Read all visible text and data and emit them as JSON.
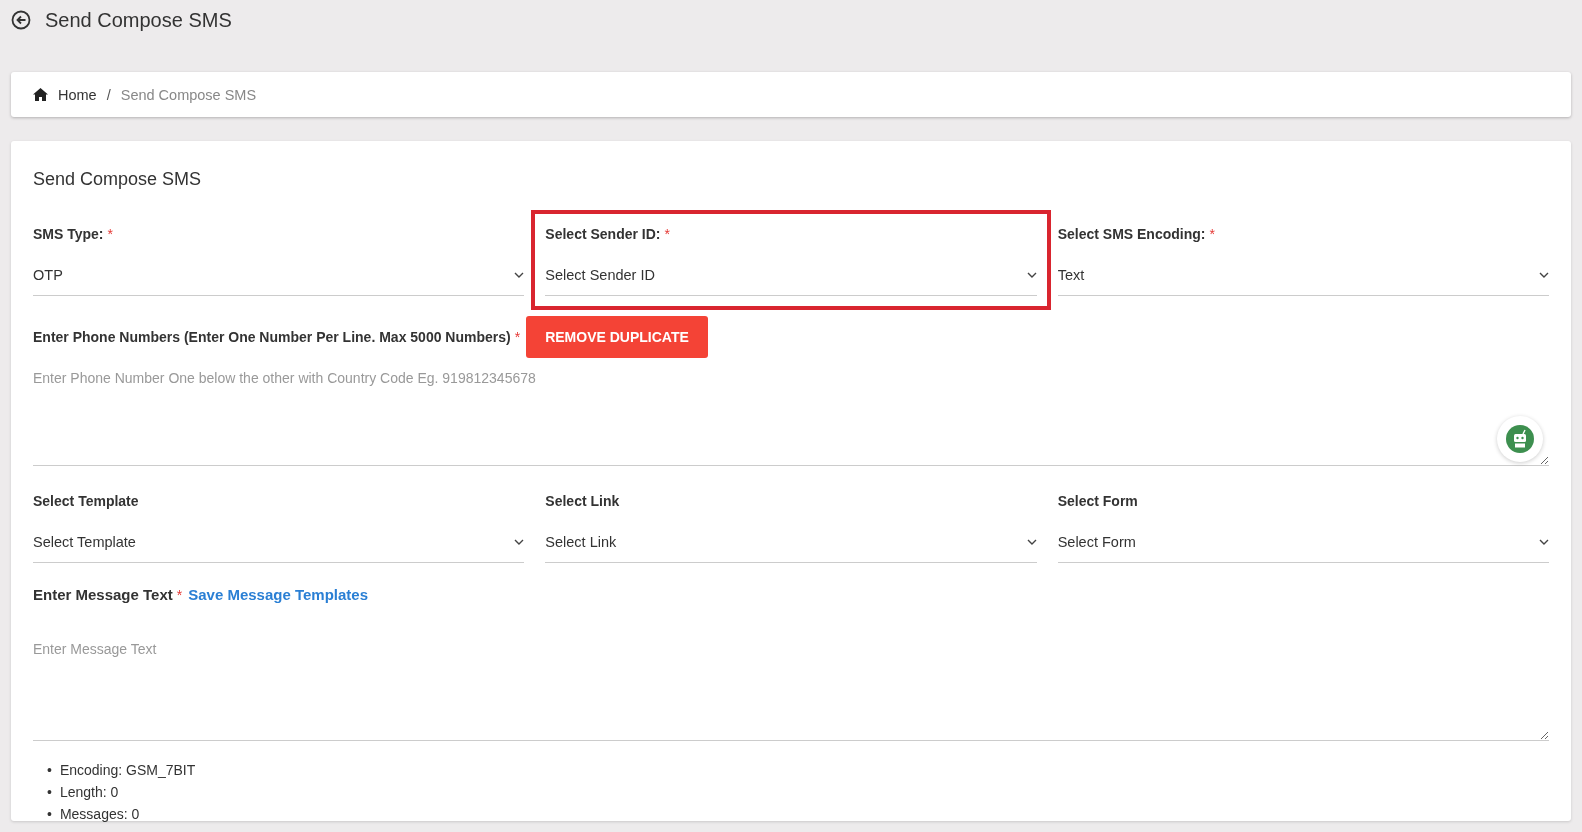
{
  "header": {
    "title": "Send Compose SMS"
  },
  "breadcrumb": [
    {
      "label": "Home",
      "current": false
    },
    {
      "label": "Send Compose SMS",
      "current": true,
      "separator": "/"
    }
  ],
  "form": {
    "title": "Send Compose SMS",
    "row_1": [
      {
        "label": "SMS Type:",
        "required_mark": "*",
        "value": "OTP",
        "highlighted": false
      },
      {
        "label": "Select Sender ID:",
        "required_mark": "*",
        "value": "Select Sender ID",
        "highlighted": true
      },
      {
        "label": "Select SMS Encoding:",
        "required_mark": "*",
        "value": "Text",
        "highlighted": false
      }
    ],
    "phone": {
      "label": "Enter Phone Numbers (Enter One Number Per Line. Max 5000 Numbers)",
      "required_mark": "*",
      "button": "REMOVE DUPLICATE",
      "placeholder": "Enter Phone Number One below the other with Country Code Eg. 919812345678"
    },
    "row_2": [
      {
        "label": "Select Template",
        "value": "Select Template",
        "highlighted": false
      },
      {
        "label": "Select Link",
        "value": "Select Link",
        "highlighted": false
      },
      {
        "label": "Select Form",
        "value": "Select Form",
        "highlighted": false
      }
    ],
    "message": {
      "label": "Enter Message Text",
      "required_mark": "*",
      "link": "Save Message Templates",
      "placeholder": "Enter Message Text"
    },
    "stats": [
      {
        "bullet": "•",
        "text": "Encoding: GSM_7BIT"
      },
      {
        "bullet": "•",
        "text": "Length: 0"
      },
      {
        "bullet": "•",
        "text": "Messages: 0"
      }
    ]
  }
}
